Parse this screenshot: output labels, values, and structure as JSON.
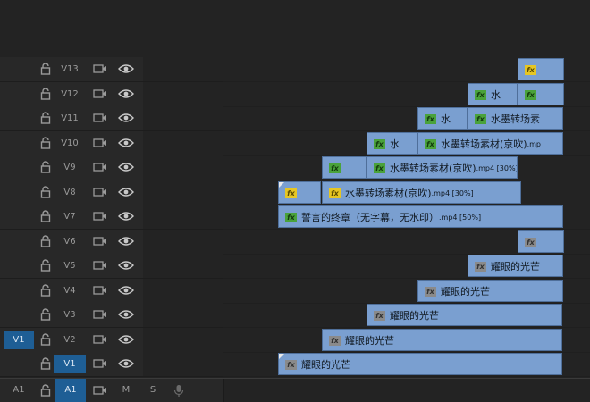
{
  "tracks": [
    {
      "name": "V13",
      "source": "",
      "target": false
    },
    {
      "name": "V12",
      "source": "",
      "target": false
    },
    {
      "name": "V11",
      "source": "",
      "target": false
    },
    {
      "name": "V10",
      "source": "",
      "target": false
    },
    {
      "name": "V9",
      "source": "",
      "target": false
    },
    {
      "name": "V8",
      "source": "",
      "target": false
    },
    {
      "name": "V7",
      "source": "",
      "target": false
    },
    {
      "name": "V6",
      "source": "",
      "target": false
    },
    {
      "name": "V5",
      "source": "",
      "target": false
    },
    {
      "name": "V4",
      "source": "",
      "target": false
    },
    {
      "name": "V3",
      "source": "",
      "target": false
    },
    {
      "name": "V2",
      "source": "V1",
      "target": false
    },
    {
      "name": "V1",
      "source": "",
      "target": true
    }
  ],
  "audio_track": {
    "source": "A1",
    "name": "A1",
    "mute": "M",
    "solo": "S"
  },
  "clips": [
    {
      "track": 0,
      "fx": "yellow",
      "label": "",
      "trans": false
    },
    {
      "track": 1,
      "fx": "green",
      "label": "水",
      "trans": false
    },
    {
      "track": 1,
      "fx": "green",
      "label": "",
      "trans": false
    },
    {
      "track": 2,
      "fx": "green",
      "label": "水",
      "trans": false
    },
    {
      "track": 2,
      "fx": "green",
      "label": "水墨转场素",
      "trans": false
    },
    {
      "track": 3,
      "fx": "green",
      "label": "水",
      "trans": false
    },
    {
      "track": 3,
      "fx": "green",
      "label": "水墨转场素材(京吹)",
      "suffix": ".mp",
      "trans": false
    },
    {
      "track": 4,
      "fx": "green",
      "label": "",
      "trans": false
    },
    {
      "track": 4,
      "fx": "green",
      "label": "水墨转场素材(京吹)",
      "suffix": ".mp4 [30%]",
      "trans": false
    },
    {
      "track": 5,
      "fx": "yellow",
      "label": "",
      "trans": true
    },
    {
      "track": 5,
      "fx": "yellow",
      "label": "水墨转场素材(京吹)",
      "suffix": ".mp4 [30%]",
      "trans": false
    },
    {
      "track": 6,
      "fx": "green",
      "label": "誓言的终章（无字幕，无水印）",
      "suffix": ".mp4 [50%]",
      "trans": false
    },
    {
      "track": 7,
      "fx": "gray",
      "label": "",
      "trans": false
    },
    {
      "track": 8,
      "fx": "gray",
      "label": "耀眼的光芒",
      "trans": false
    },
    {
      "track": 9,
      "fx": "gray",
      "label": "耀眼的光芒",
      "trans": false
    },
    {
      "track": 10,
      "fx": "gray",
      "label": "耀眼的光芒",
      "trans": false
    },
    {
      "track": 11,
      "fx": "gray",
      "label": "耀眼的光芒",
      "trans": false
    },
    {
      "track": 12,
      "fx": "gray",
      "label": "耀眼的光芒",
      "trans": true
    }
  ],
  "fx_label": "fx",
  "colors": {
    "clip": "#7a9fd0",
    "target": "#1e5e95",
    "fx_green": "#4aa23b",
    "fx_yellow": "#e6c623",
    "fx_gray": "#8a8a8a"
  }
}
